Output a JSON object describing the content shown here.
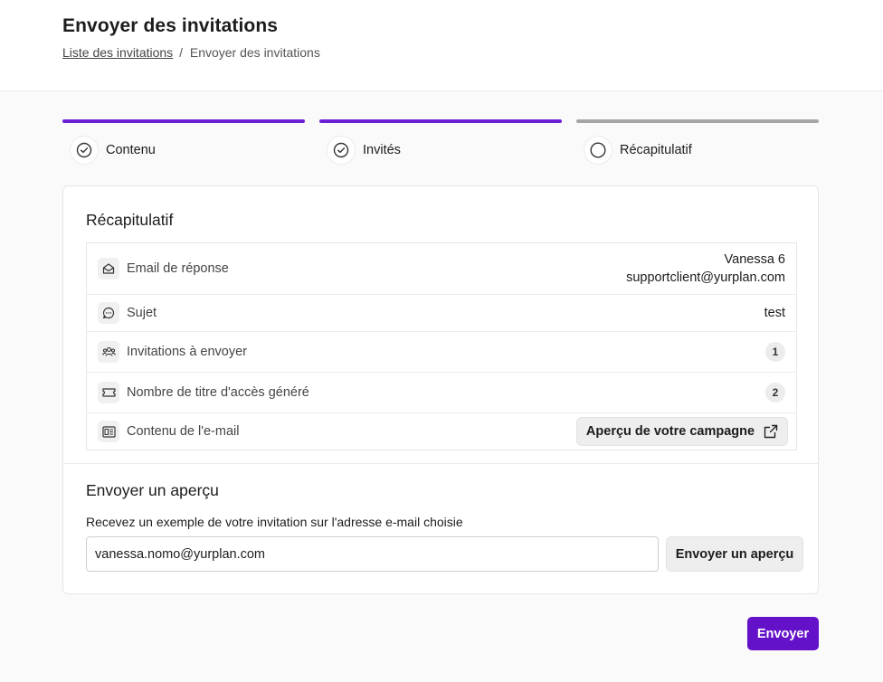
{
  "header": {
    "title": "Envoyer des invitations",
    "breadcrumb": {
      "link": "Liste des invitations",
      "separator": "/",
      "current": "Envoyer des invitations"
    }
  },
  "steps": [
    {
      "label": "Contenu",
      "state": "complete",
      "icon": "check-circle-icon"
    },
    {
      "label": "Invités",
      "state": "complete",
      "icon": "check-circle-icon"
    },
    {
      "label": "Récapitulatif",
      "state": "current",
      "icon": "empty-circle-icon"
    }
  ],
  "summary": {
    "title": "Récapitulatif",
    "rows": {
      "reply_email": {
        "label": "Email de réponse",
        "name": "Vanessa 6",
        "email": "supportclient@yurplan.com",
        "icon": "envelope-open-icon"
      },
      "subject": {
        "label": "Sujet",
        "value": "test",
        "icon": "chat-bubble-icon"
      },
      "invitations": {
        "label": "Invitations à envoyer",
        "value": "1",
        "icon": "users-icon"
      },
      "tickets": {
        "label": "Nombre de titre d'accès généré",
        "value": "2",
        "icon": "ticket-icon"
      },
      "email_content": {
        "label": "Contenu de l'e-mail",
        "button": "Aperçu de votre campagne",
        "icon": "email-template-icon",
        "button_icon": "external-link-icon"
      }
    }
  },
  "preview": {
    "title": "Envoyer un aperçu",
    "hint": "Recevez un exemple de votre invitation sur l'adresse e-mail choisie",
    "email_value": "vanessa.nomo@yurplan.com",
    "button": "Envoyer un aperçu"
  },
  "footer": {
    "send_button": "Envoyer"
  },
  "colors": {
    "accent": "#6d1fd6",
    "primary_button": "#6412c9",
    "inactive_step": "#a6a6a6"
  }
}
